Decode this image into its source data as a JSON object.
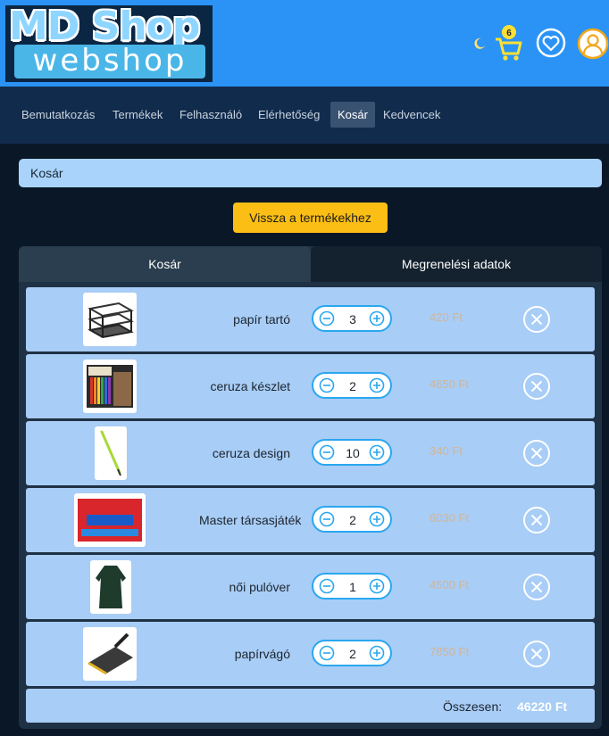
{
  "logo": {
    "line1": "MD Shop",
    "line2": "webshop"
  },
  "header_icons": [
    "moon-icon",
    "cart-icon",
    "heart-icon",
    "user-icon"
  ],
  "cart_count": "6",
  "nav": {
    "items": [
      "Bemutatkozás",
      "Termékek",
      "Felhasználó",
      "Elérhetőség",
      "Kosár",
      "Kedvencek"
    ],
    "active": "Kosár"
  },
  "breadcrumb": "Kosár",
  "back_button": "Vissza a termékekhez",
  "tabs": [
    "Kosár",
    "Megrenelési adatok"
  ],
  "cart": {
    "items": [
      {
        "name": "papír tartó",
        "qty": "3",
        "price": "420 Ft"
      },
      {
        "name": "ceruza készlet",
        "qty": "2",
        "price": "4650 Ft"
      },
      {
        "name": "ceruza design",
        "qty": "10",
        "price": "340 Ft"
      },
      {
        "name": "Master társasjáték",
        "qty": "2",
        "price": "6030 Ft"
      },
      {
        "name": "női pulóver",
        "qty": "1",
        "price": "4500 Ft"
      },
      {
        "name": "papírvágó",
        "qty": "2",
        "price": "7850 Ft"
      }
    ],
    "total_label": "Összesen:",
    "total_value": "46220 Ft"
  },
  "colors": {
    "header": "#2a93f5",
    "nav": "#112b4d",
    "row": "#a8cdf6",
    "accent_button": "#fbbe14",
    "stepper_border": "#2aa7f0",
    "price": "#f4a24c"
  }
}
